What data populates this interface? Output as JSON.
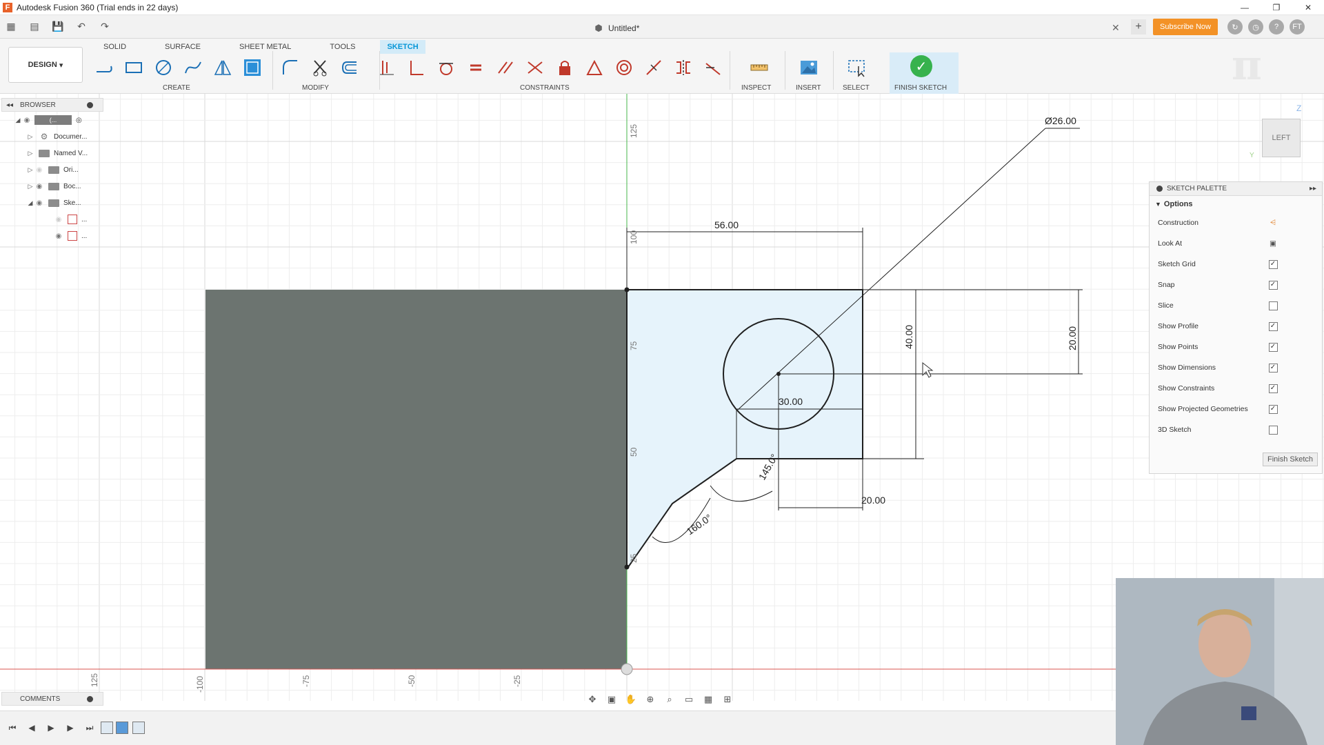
{
  "window": {
    "title": "Autodesk Fusion 360 (Trial ends in 22 days)"
  },
  "document": {
    "title": "Untitled*"
  },
  "account": {
    "subscribe_label": "Subscribe Now",
    "user_initials": "FT"
  },
  "workspace": {
    "mode_label": "DESIGN"
  },
  "tabs": [
    {
      "label": "SOLID"
    },
    {
      "label": "SURFACE"
    },
    {
      "label": "SHEET METAL"
    },
    {
      "label": "TOOLS"
    },
    {
      "label": "SKETCH"
    }
  ],
  "tool_groups": {
    "create": "CREATE",
    "modify": "MODIFY",
    "constraints": "CONSTRAINTS",
    "inspect": "INSPECT",
    "insert": "INSERT",
    "select": "SELECT",
    "finish": "FINISH SKETCH"
  },
  "browser": {
    "title": "BROWSER",
    "root_label": "(...",
    "items": [
      {
        "label": "Documer..."
      },
      {
        "label": "Named V..."
      },
      {
        "label": "Ori..."
      },
      {
        "label": "Boc..."
      },
      {
        "label": "Ske..."
      }
    ],
    "sketch_children": [
      {
        "label": "..."
      },
      {
        "label": "..."
      }
    ]
  },
  "comments": {
    "title": "COMMENTS"
  },
  "viewcube": {
    "face": "LEFT",
    "axis_z": "Z",
    "axis_y": "Y"
  },
  "sketch_palette": {
    "title": "SKETCH PALETTE",
    "section": "Options",
    "options": [
      {
        "label": "Construction",
        "type": "icon",
        "icon": "construction-icon"
      },
      {
        "label": "Look At",
        "type": "icon",
        "icon": "look-at-icon"
      },
      {
        "label": "Sketch Grid",
        "type": "checkbox",
        "checked": true
      },
      {
        "label": "Snap",
        "type": "checkbox",
        "checked": true
      },
      {
        "label": "Slice",
        "type": "checkbox",
        "checked": false
      },
      {
        "label": "Show Profile",
        "type": "checkbox",
        "checked": true
      },
      {
        "label": "Show Points",
        "type": "checkbox",
        "checked": true
      },
      {
        "label": "Show Dimensions",
        "type": "checkbox",
        "checked": true
      },
      {
        "label": "Show Constraints",
        "type": "checkbox",
        "checked": true
      },
      {
        "label": "Show Projected Geometries",
        "type": "checkbox",
        "checked": true
      },
      {
        "label": "3D Sketch",
        "type": "checkbox",
        "checked": false
      }
    ],
    "finish_button": "Finish Sketch"
  },
  "sketch": {
    "dimensions": {
      "diameter": "Ø26.00",
      "width": "56.00",
      "height": "40.00",
      "right_offset": "20.00",
      "inner_width": "30.00",
      "bottom_offset": "20.00",
      "angle_upper": "145.0°",
      "angle_lower": "160.0°"
    },
    "ruler_vertical": [
      "125",
      "100",
      "75",
      "50",
      "25"
    ],
    "ruler_horizontal": [
      "125",
      "-100",
      "-75",
      "-50",
      "-25"
    ]
  },
  "colors": {
    "accent": "#0696d7",
    "subscribe": "#f39227",
    "finish_check": "#37b24d",
    "body_fill": "#6c7470",
    "profile_fill": "#e6f3fb"
  }
}
